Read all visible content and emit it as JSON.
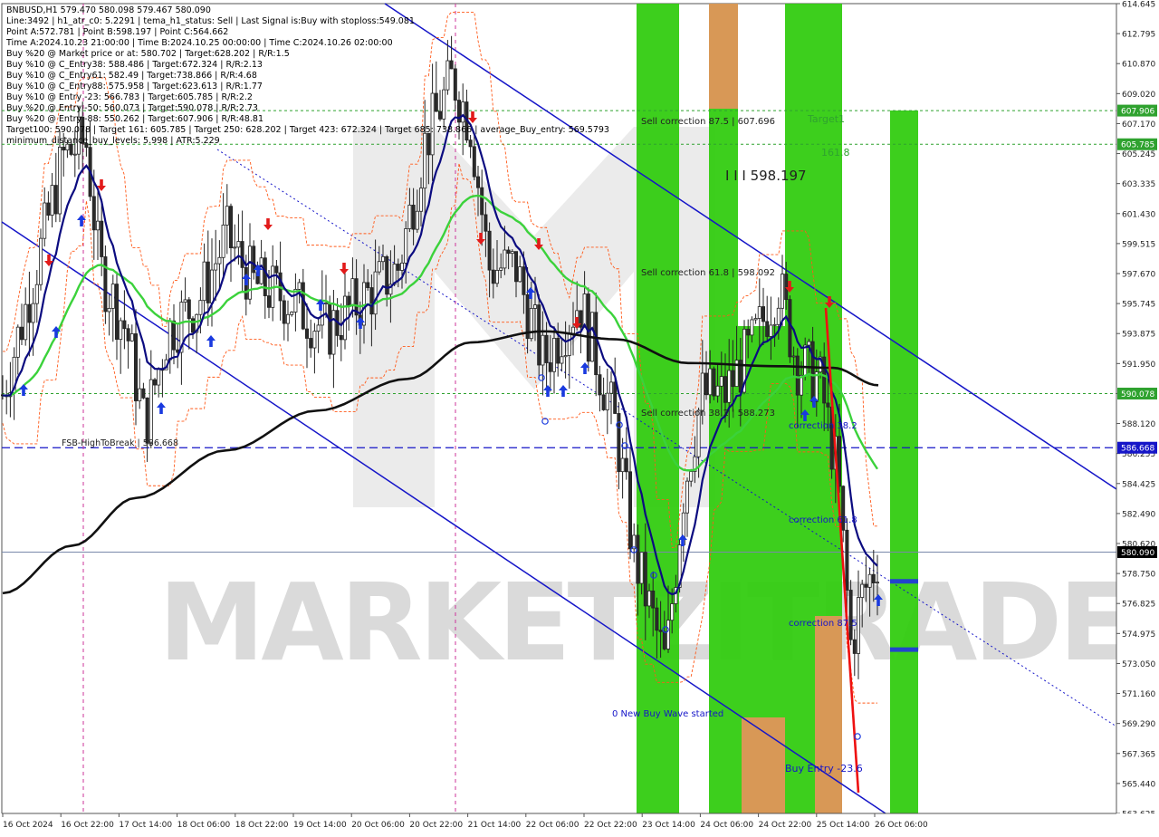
{
  "header": {
    "lines": [
      "BNBUSD,H1   579.470 580.098 579.467 580.090",
      "Line:3492  |  h1_atr_c0: 5.2291  |  tema_h1_status: Sell  |  Last Signal is:Buy with stoploss:549.081",
      "Point A:572.781  |  Point B:598.197  |  Point C:564.662",
      "Time A:2024.10.23 21:00:00  |  Time B:2024.10.25 00:00:00  |  Time C:2024.10.26 02:00:00",
      "Buy %20 @ Market price or at: 580.702  |  Target:628.202  |  R/R:1.5",
      "Buy %10 @ C_Entry38: 588.486  |  Target:672.324  |  R/R:2.13",
      "Buy %10 @ C_Entry61: 582.49  |  Target:738.866  |  R/R:4.68",
      "Buy %10 @ C_Entry88: 575.958  |  Target:623.613  |  R/R:1.77",
      "Buy %10 @ Entry -23: 566.783  |  Target:605.785  |  R/R:2.2",
      "Buy %20 @ Entry -50: 560.073  |  Target:590.078  |  R/R:2.73",
      "Buy %20 @ Entry -88: 550.262  |  Target:607.906  |  R/R:48.81",
      "Target100: 590.078  |  Target 161: 605.785  |  Target 250: 628.202  |  Target 423: 672.324  |  Target 685: 738.866  |  average_Buy_entry: 569.5793",
      "minimum_distance_buy_levels: 5.998  |  ATR:5.229"
    ]
  },
  "chart_data": {
    "type": "candlestick",
    "symbol": "BNBUSD,H1",
    "ylim": [
      563.625,
      614.645
    ],
    "y_ticks": [
      "614.645",
      "612.795",
      "610.870",
      "609.020",
      "607.170",
      "605.245",
      "603.335",
      "601.430",
      "599.515",
      "597.670",
      "595.745",
      "593.875",
      "591.950",
      "590.025",
      "588.120",
      "586.255",
      "584.425",
      "582.490",
      "580.620",
      "578.750",
      "576.825",
      "574.975",
      "573.050",
      "571.160",
      "569.290",
      "567.365",
      "565.440",
      "563.625"
    ],
    "x_labels": [
      "16 Oct 2024",
      "16 Oct 22:00",
      "17 Oct 14:00",
      "18 Oct 06:00",
      "18 Oct 22:00",
      "19 Oct 14:00",
      "20 Oct 06:00",
      "20 Oct 22:00",
      "21 Oct 14:00",
      "22 Oct 06:00",
      "22 Oct 22:00",
      "23 Oct 14:00",
      "24 Oct 06:00",
      "24 Oct 22:00",
      "25 Oct 14:00",
      "26 Oct 06:00"
    ],
    "price_badges": [
      {
        "value": "607.906",
        "color": "#2fa22f"
      },
      {
        "value": "605.785",
        "color": "#2fa22f"
      },
      {
        "value": "590.078",
        "color": "#2fa22f"
      },
      {
        "value": "586.668",
        "color": "#1515c8"
      },
      {
        "value": "580.090",
        "color": "#000000"
      }
    ],
    "annotations": {
      "sell_correction_875": "Sell correction 87.5 | 607.696",
      "sell_correction_618": "Sell correction 61.8 | 598.092",
      "sell_correction_382": "Sell correction 38.2 | 588.273",
      "point_b_label": "I I I 598.197",
      "target1": "Target1",
      "fib_1618": "161.8",
      "correction_382": "correction 38.2",
      "correction_618": "correction 61.8",
      "correction_875": "correction 87.5",
      "new_buy_wave": "0 New Buy Wave started",
      "buy_entry": "Buy Entry -23.6",
      "fsb_label": "FSB-HighToBreak | 586.668"
    },
    "current_price": 580.09,
    "watermark": "MARKETZITRADE",
    "colors": {
      "green_zone": "#33cc11",
      "orange_zone": "#e0955a",
      "target_line": "#2fa22f",
      "fsb_line": "#1515c8",
      "channel": "#1515c8",
      "ema_green": "#3bd23b",
      "ema_navy": "#0b0b80",
      "sma_black": "#111111",
      "envelope": "#ff5a1a",
      "bull_candle": "#2b2b2b",
      "bear_candle": "#2b2b2b",
      "signal_up": "#1a3adf",
      "signal_down": "#e21a1a"
    }
  }
}
